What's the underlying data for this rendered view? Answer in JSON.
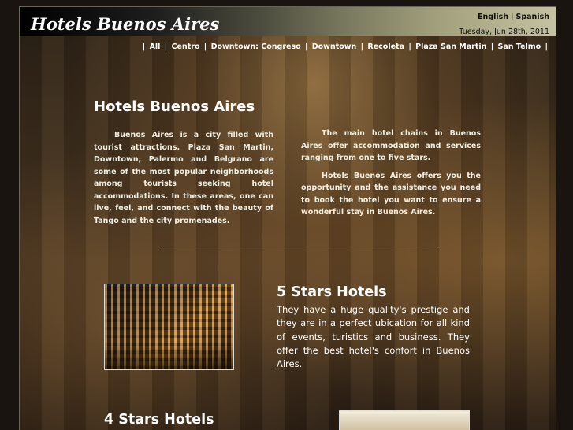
{
  "header": {
    "title": "Hotels Buenos Aires",
    "lang_english": "English",
    "lang_separator": "|",
    "lang_spanish": "Spanish",
    "date": "Tuesday, Jun 28th, 2011"
  },
  "nav": {
    "items": [
      "All",
      "Centro",
      "Downtown: Congreso",
      "Downtown",
      "Recoleta",
      "Plaza San Martin",
      "San Telmo"
    ],
    "separator": "|"
  },
  "intro": {
    "title": "Hotels Buenos Aires",
    "col1_p1": "Buenos Aires is a city filled with tourist attractions. Plaza San Martin, Downtown, Palermo and Belgrano are some of the most popular neighborhoods among tourists seeking hotel accommodations. In these areas, one can live, feel, and connect with the beauty of Tango and the city promenades.",
    "col2_p1": "The main hotel chains in Buenos Aires offer accommodation and services ranging from one to five stars.",
    "col2_p2": "Hotels Buenos Aires offers you the opportunity and the assistance you need to book the hotel you want to ensure a wonderful stay in Buenos Aires."
  },
  "five_stars": {
    "title": "5 Stars Hotels",
    "text": "They have a huge quality's prestige and they are in a perfect ubication for all kind of events, turistics and business. They offer the best hotel's confort in Buenos Aires."
  },
  "four_stars": {
    "title": "4 Stars Hotels"
  }
}
